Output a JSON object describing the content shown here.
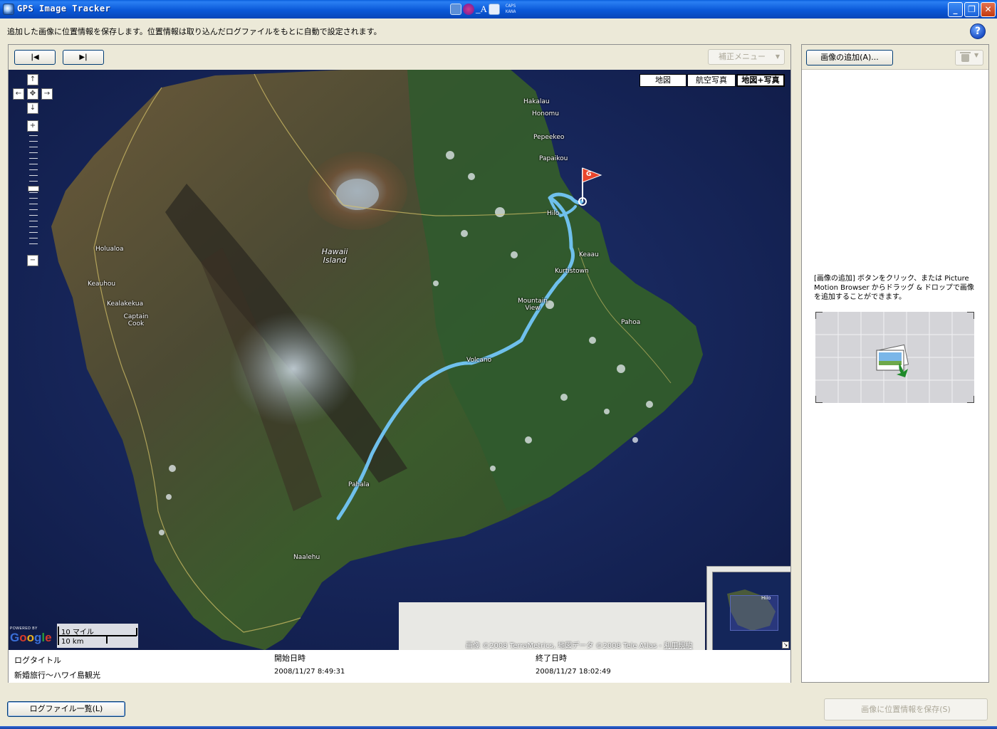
{
  "window": {
    "title": "GPS Image Tracker",
    "ime_indicators": [
      "CAPS",
      "KANA"
    ],
    "minimize_icon": "minimize-icon",
    "maximize_icon": "restore-icon",
    "close_icon": "close-icon"
  },
  "description": "追加した画像に位置情報を保存します。位置情報は取り込んだログファイルをもとに自動で設定されます。",
  "help_label": "?",
  "toolbar": {
    "prev_label": "|◀",
    "next_label": "▶|",
    "correct_menu_label": "補正メニュー"
  },
  "map": {
    "types": [
      "地図",
      "航空写真",
      "地図+写真"
    ],
    "selected_type": "地図+写真",
    "places": [
      {
        "name": "Hakalau"
      },
      {
        "name": "Honomu"
      },
      {
        "name": "Pepeekeo"
      },
      {
        "name": "Papaikou"
      },
      {
        "name": "Hilo"
      },
      {
        "name": "Keaau"
      },
      {
        "name": "Kurtistown"
      },
      {
        "name": "Mountain View"
      },
      {
        "name": "Pahoa"
      },
      {
        "name": "Volcano"
      },
      {
        "name": "Pahala"
      },
      {
        "name": "Naalehu"
      },
      {
        "name": "Holualoa"
      },
      {
        "name": "Keauhou"
      },
      {
        "name": "Kealakekua"
      },
      {
        "name": "Captain Cook"
      },
      {
        "name": "Hawaii Island"
      }
    ],
    "scale_miles": "10 マイル",
    "scale_km": "10 km",
    "powered_by": "POWERED BY",
    "google": "Google",
    "attribution": "画像 ©2008 TerraMetrics, 地図データ ©2008 Tele Atlas - ",
    "terms_link": "利用規約",
    "overview_label": "Hilo",
    "goal_marker": "G"
  },
  "log": {
    "headers": {
      "title": "ログタイトル",
      "start": "開始日時",
      "end": "終了日時"
    },
    "title": "新婚旅行～ハワイ島観光",
    "start": "2008/11/27 8:49:31",
    "end": "2008/11/27 18:02:49"
  },
  "right_panel": {
    "add_button_label": "画像の追加(A)...",
    "hint": "[画像の追加] ボタンをクリック、または Picture Motion Browser からドラッグ & ドロップで画像を追加することができます。"
  },
  "footer": {
    "logfile_list_label": "ログファイル一覧(L)",
    "save_label": "画像に位置情報を保存(S)"
  }
}
